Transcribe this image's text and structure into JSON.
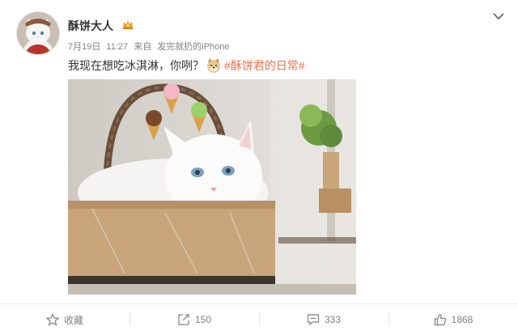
{
  "post": {
    "username": "酥饼大人",
    "meta": {
      "date": "7月19日",
      "time": "11:27",
      "source_prefix": "来自",
      "source": "发完就扔的iPhone"
    },
    "text": "我现在想吃冰淇淋，你咧？",
    "topic": "#酥饼君的日常#"
  },
  "actions": {
    "favorite_label": "收藏",
    "repost_count": "150",
    "comment_count": "333",
    "like_count": "1868"
  },
  "icons": {
    "badge": "vip-crown-icon",
    "menu": "chevron-down-icon",
    "emoji": "doge-emoji-icon",
    "favorite": "star-icon",
    "repost": "share-arrow-icon",
    "comment": "comment-bubble-icon",
    "like": "thumbs-up-icon"
  },
  "colors": {
    "topic": "#eb7350",
    "text": "#333333",
    "meta": "#808080"
  }
}
